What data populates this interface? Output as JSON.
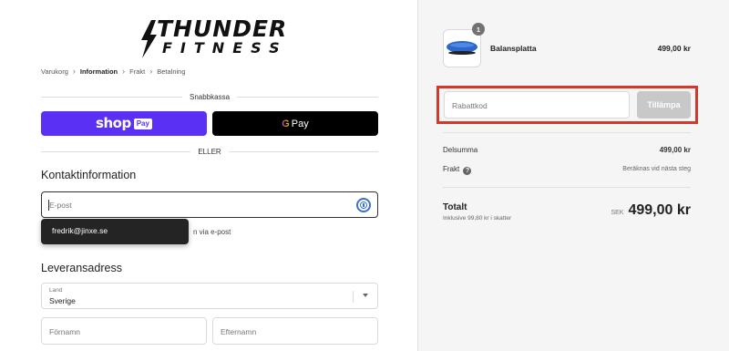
{
  "logo": {
    "line1": "THUNDER",
    "line2": "FITNESS"
  },
  "breadcrumb": {
    "cart": "Varukorg",
    "information": "Information",
    "shipping": "Frakt",
    "payment": "Betalning",
    "separator": "›"
  },
  "express": {
    "label": "Snabbkassa",
    "shop_text": "shop",
    "shop_pay": "Pay",
    "gpay_g": "G",
    "gpay_text": "Pay"
  },
  "or_label": "ELLER",
  "contact": {
    "title": "Kontaktinformation",
    "email_placeholder": "E-post",
    "autocomplete_email": "fredrik@jinxe.se",
    "optin_text": "n via e-post"
  },
  "shipping": {
    "title": "Leveransadress",
    "country_label": "Land",
    "country_value": "Sverige",
    "first_name_placeholder": "Förnamn",
    "last_name_placeholder": "Efternamn"
  },
  "summary": {
    "product": {
      "name": "Balansplatta",
      "price": "499,00 kr",
      "quantity": "1"
    },
    "discount_placeholder": "Rabattkod",
    "apply_label": "Tillämpa",
    "subtotal_label": "Delsumma",
    "subtotal_value": "499,00 kr",
    "shipping_label": "Frakt",
    "shipping_help": "?",
    "shipping_value": "Beräknas vid nästa steg",
    "total_label": "Totalt",
    "tax_note": "Inklusive 99,80 kr i skatter",
    "currency": "SEK",
    "total_value": "499,00 kr"
  },
  "colors": {
    "shop_pay": "#5a31f4",
    "highlight": "#d3382a",
    "apply_disabled": "#c8c8c8",
    "link_blue": "#3b6fd6"
  },
  "icons": {
    "email_field": "info-icon",
    "select": "chevron-down-icon",
    "shipping_help": "question-icon",
    "logo": "lightning-bolt-icon"
  }
}
